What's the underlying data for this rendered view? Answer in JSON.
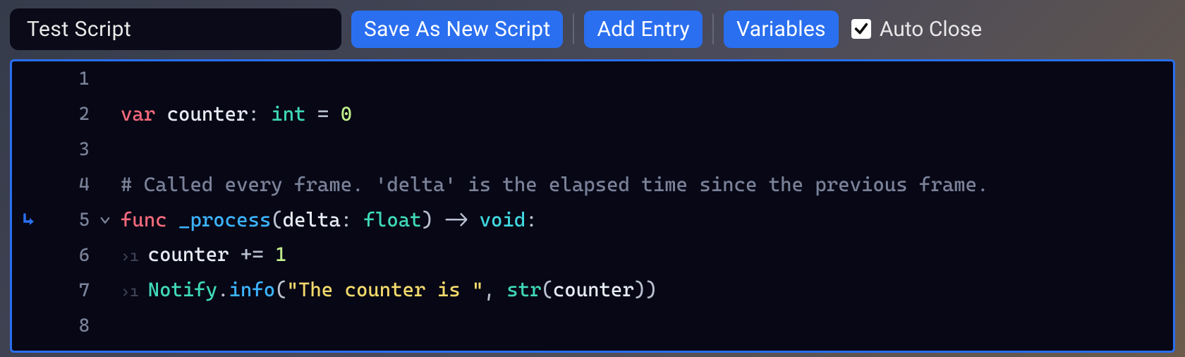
{
  "toolbar": {
    "script_name": "Test Script",
    "save_as_label": "Save As New Script",
    "add_entry_label": "Add Entry",
    "variables_label": "Variables",
    "auto_close_label": "Auto Close",
    "auto_close_checked": true
  },
  "colors": {
    "accent": "#2a6ff0",
    "bg_editor": "#070715",
    "keyword": "#f36a7b",
    "type": "#3fd9b8",
    "builtin": "#40d9e0",
    "number": "#c2f08d",
    "comment": "#7a8299",
    "funcname": "#3cb4ff",
    "string": "#f2d96b",
    "punct": "#b9c0d0",
    "ident": "#e8ecf5"
  },
  "editor": {
    "lines": [
      {
        "n": 1,
        "fold": false,
        "indent_marks": 0,
        "gutter_icon": null,
        "tokens": []
      },
      {
        "n": 2,
        "fold": false,
        "indent_marks": 0,
        "gutter_icon": null,
        "tokens": [
          {
            "t": "keyword",
            "s": "var"
          },
          {
            "t": "plain",
            "s": " "
          },
          {
            "t": "ident",
            "s": "counter"
          },
          {
            "t": "punct",
            "s": ":"
          },
          {
            "t": "plain",
            "s": " "
          },
          {
            "t": "type",
            "s": "int"
          },
          {
            "t": "plain",
            "s": " "
          },
          {
            "t": "op",
            "s": "="
          },
          {
            "t": "plain",
            "s": " "
          },
          {
            "t": "number",
            "s": "0"
          }
        ]
      },
      {
        "n": 3,
        "fold": false,
        "indent_marks": 0,
        "gutter_icon": null,
        "tokens": []
      },
      {
        "n": 4,
        "fold": false,
        "indent_marks": 0,
        "gutter_icon": null,
        "tokens": [
          {
            "t": "comment",
            "s": "# Called every frame. 'delta' is the elapsed time since the previous frame."
          }
        ]
      },
      {
        "n": 5,
        "fold": true,
        "indent_marks": 0,
        "gutter_icon": "enter-arrow",
        "tokens": [
          {
            "t": "keyword",
            "s": "func"
          },
          {
            "t": "plain",
            "s": " "
          },
          {
            "t": "funcname",
            "s": "_process"
          },
          {
            "t": "punct",
            "s": "("
          },
          {
            "t": "ident",
            "s": "delta"
          },
          {
            "t": "punct",
            "s": ":"
          },
          {
            "t": "plain",
            "s": " "
          },
          {
            "t": "type",
            "s": "float"
          },
          {
            "t": "punct",
            "s": ")"
          },
          {
            "t": "plain",
            "s": " "
          },
          {
            "t": "op",
            "s": "->"
          },
          {
            "t": "plain",
            "s": " "
          },
          {
            "t": "builtin",
            "s": "void"
          },
          {
            "t": "punct",
            "s": ":"
          }
        ]
      },
      {
        "n": 6,
        "fold": false,
        "indent_marks": 1,
        "gutter_icon": null,
        "tokens": [
          {
            "t": "ident",
            "s": "counter"
          },
          {
            "t": "plain",
            "s": " "
          },
          {
            "t": "op",
            "s": "+="
          },
          {
            "t": "plain",
            "s": " "
          },
          {
            "t": "number",
            "s": "1"
          }
        ]
      },
      {
        "n": 7,
        "fold": false,
        "indent_marks": 1,
        "gutter_icon": null,
        "tokens": [
          {
            "t": "class",
            "s": "Notify"
          },
          {
            "t": "punct",
            "s": "."
          },
          {
            "t": "method",
            "s": "info"
          },
          {
            "t": "punct",
            "s": "("
          },
          {
            "t": "string",
            "s": "\"The counter is \""
          },
          {
            "t": "punct",
            "s": ","
          },
          {
            "t": "plain",
            "s": " "
          },
          {
            "t": "class",
            "s": "str"
          },
          {
            "t": "punct",
            "s": "("
          },
          {
            "t": "ident",
            "s": "counter"
          },
          {
            "t": "punct",
            "s": ")"
          },
          {
            "t": "punct",
            "s": ")"
          }
        ]
      },
      {
        "n": 8,
        "fold": false,
        "indent_marks": 0,
        "gutter_icon": null,
        "tokens": []
      }
    ]
  }
}
